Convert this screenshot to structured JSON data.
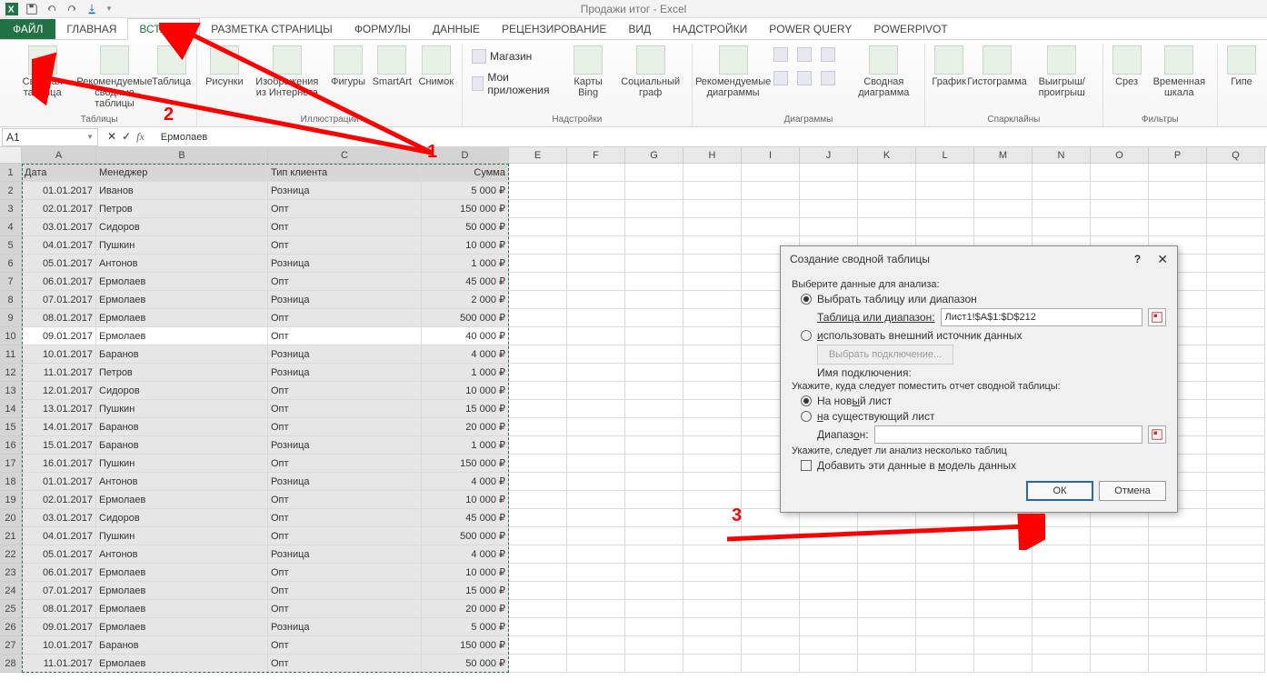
{
  "title": "Продажи итог - Excel",
  "tabs": {
    "file": "ФАЙЛ",
    "home": "ГЛАВНАЯ",
    "insert": "ВСТАВКА",
    "layout": "РАЗМЕТКА СТРАНИЦЫ",
    "formulas": "ФОРМУЛЫ",
    "data": "ДАННЫЕ",
    "review": "РЕЦЕНЗИРОВАНИЕ",
    "view": "ВИД",
    "addins": "НАДСТРОЙКИ",
    "pq": "POWER QUERY",
    "pp": "POWERPIVOT"
  },
  "ribbon": {
    "pivot": {
      "label": "Таблицы",
      "btn1": "Сводная таблица",
      "btn2": "Рекомендуемые сводные таблицы",
      "btn3": "Таблица"
    },
    "illus": {
      "label": "Иллюстрации",
      "b1": "Рисунки",
      "b2": "Изображения из Интернета",
      "b3": "Фигуры",
      "b4": "SmartArt",
      "b5": "Снимок"
    },
    "addins": {
      "label": "Надстройки",
      "b1": "Магазин",
      "b2": "Мои приложения",
      "b3": "Карты Bing",
      "b4": "Социальный граф"
    },
    "charts": {
      "label": "Диаграммы",
      "b1": "Рекомендуемые диаграммы",
      "b2": "Сводная диаграмма"
    },
    "spark": {
      "label": "Спарклайны",
      "b1": "График",
      "b2": "Гистограмма",
      "b3": "Выигрыш/ проигрыш"
    },
    "filter": {
      "label": "Фильтры",
      "b1": "Срез",
      "b2": "Временная шкала"
    },
    "link": {
      "b1": "Гипе"
    }
  },
  "namebox": "A1",
  "formula": "Ермолаев",
  "headers": [
    "Дата",
    "Менеджер",
    "Тип клиента",
    "Сумма"
  ],
  "cols": [
    "A",
    "B",
    "C",
    "D",
    "E",
    "F",
    "G",
    "H",
    "I",
    "J",
    "K",
    "L",
    "M",
    "N",
    "O",
    "P",
    "Q"
  ],
  "rows": [
    {
      "d": "01.01.2017",
      "m": "Иванов",
      "t": "Розница",
      "s": "5 000 ₽"
    },
    {
      "d": "02.01.2017",
      "m": "Петров",
      "t": "Опт",
      "s": "150 000 ₽"
    },
    {
      "d": "03.01.2017",
      "m": "Сидоров",
      "t": "Опт",
      "s": "50 000 ₽"
    },
    {
      "d": "04.01.2017",
      "m": "Пушкин",
      "t": "Опт",
      "s": "10 000 ₽"
    },
    {
      "d": "05.01.2017",
      "m": "Антонов",
      "t": "Розница",
      "s": "1 000 ₽"
    },
    {
      "d": "06.01.2017",
      "m": "Ермолаев",
      "t": "Опт",
      "s": "45 000 ₽"
    },
    {
      "d": "07.01.2017",
      "m": "Ермолаев",
      "t": "Розница",
      "s": "2 000 ₽"
    },
    {
      "d": "08.01.2017",
      "m": "Ермолаев",
      "t": "Опт",
      "s": "500 000 ₽"
    },
    {
      "d": "09.01.2017",
      "m": "Ермолаев",
      "t": "Опт",
      "s": "40 000 ₽",
      "white": true
    },
    {
      "d": "10.01.2017",
      "m": "Баранов",
      "t": "Розница",
      "s": "4 000 ₽"
    },
    {
      "d": "11.01.2017",
      "m": "Петров",
      "t": "Розница",
      "s": "1 000 ₽"
    },
    {
      "d": "12.01.2017",
      "m": "Сидоров",
      "t": "Опт",
      "s": "10 000 ₽"
    },
    {
      "d": "13.01.2017",
      "m": "Пушкин",
      "t": "Опт",
      "s": "15 000 ₽"
    },
    {
      "d": "14.01.2017",
      "m": "Баранов",
      "t": "Опт",
      "s": "20 000 ₽"
    },
    {
      "d": "15.01.2017",
      "m": "Баранов",
      "t": "Розница",
      "s": "1 000 ₽"
    },
    {
      "d": "16.01.2017",
      "m": "Пушкин",
      "t": "Опт",
      "s": "150 000 ₽"
    },
    {
      "d": "01.01.2017",
      "m": "Антонов",
      "t": "Розница",
      "s": "4 000 ₽"
    },
    {
      "d": "02.01.2017",
      "m": "Ермолаев",
      "t": "Опт",
      "s": "10 000 ₽"
    },
    {
      "d": "03.01.2017",
      "m": "Сидоров",
      "t": "Опт",
      "s": "45 000 ₽"
    },
    {
      "d": "04.01.2017",
      "m": "Пушкин",
      "t": "Опт",
      "s": "500 000 ₽"
    },
    {
      "d": "05.01.2017",
      "m": "Антонов",
      "t": "Розница",
      "s": "4 000 ₽"
    },
    {
      "d": "06.01.2017",
      "m": "Ермолаев",
      "t": "Опт",
      "s": "10 000 ₽"
    },
    {
      "d": "07.01.2017",
      "m": "Ермолаев",
      "t": "Опт",
      "s": "15 000 ₽"
    },
    {
      "d": "08.01.2017",
      "m": "Ермолаев",
      "t": "Опт",
      "s": "20 000 ₽"
    },
    {
      "d": "09.01.2017",
      "m": "Ермолаев",
      "t": "Розница",
      "s": "5 000 ₽"
    },
    {
      "d": "10.01.2017",
      "m": "Баранов",
      "t": "Опт",
      "s": "150 000 ₽"
    },
    {
      "d": "11.01.2017",
      "m": "Ермолаев",
      "t": "Опт",
      "s": "50 000 ₽"
    }
  ],
  "dialog": {
    "title": "Создание сводной таблицы",
    "s1": "Выберите данные для анализа:",
    "r1": "Выбрать таблицу или диапазон",
    "range_lbl": "Таблица или диапазон:",
    "range_val": "Лист1!$A$1:$D$212",
    "r2": "использовать внешний источник данных",
    "conn_btn": "Выбрать подключение...",
    "conn_lbl": "Имя подключения:",
    "s2": "Укажите, куда следует поместить отчет сводной таблицы:",
    "r3": "На новый лист",
    "r4": "на существующий лист",
    "range2_lbl": "Диапазон:",
    "s3": "Укажите, следует ли анализ несколько таблиц",
    "chk": "Добавить эти данные в модель данных",
    "ok": "ОК",
    "cancel": "Отмена"
  },
  "annotations": {
    "a1": "1",
    "a2": "2",
    "a3": "3"
  }
}
